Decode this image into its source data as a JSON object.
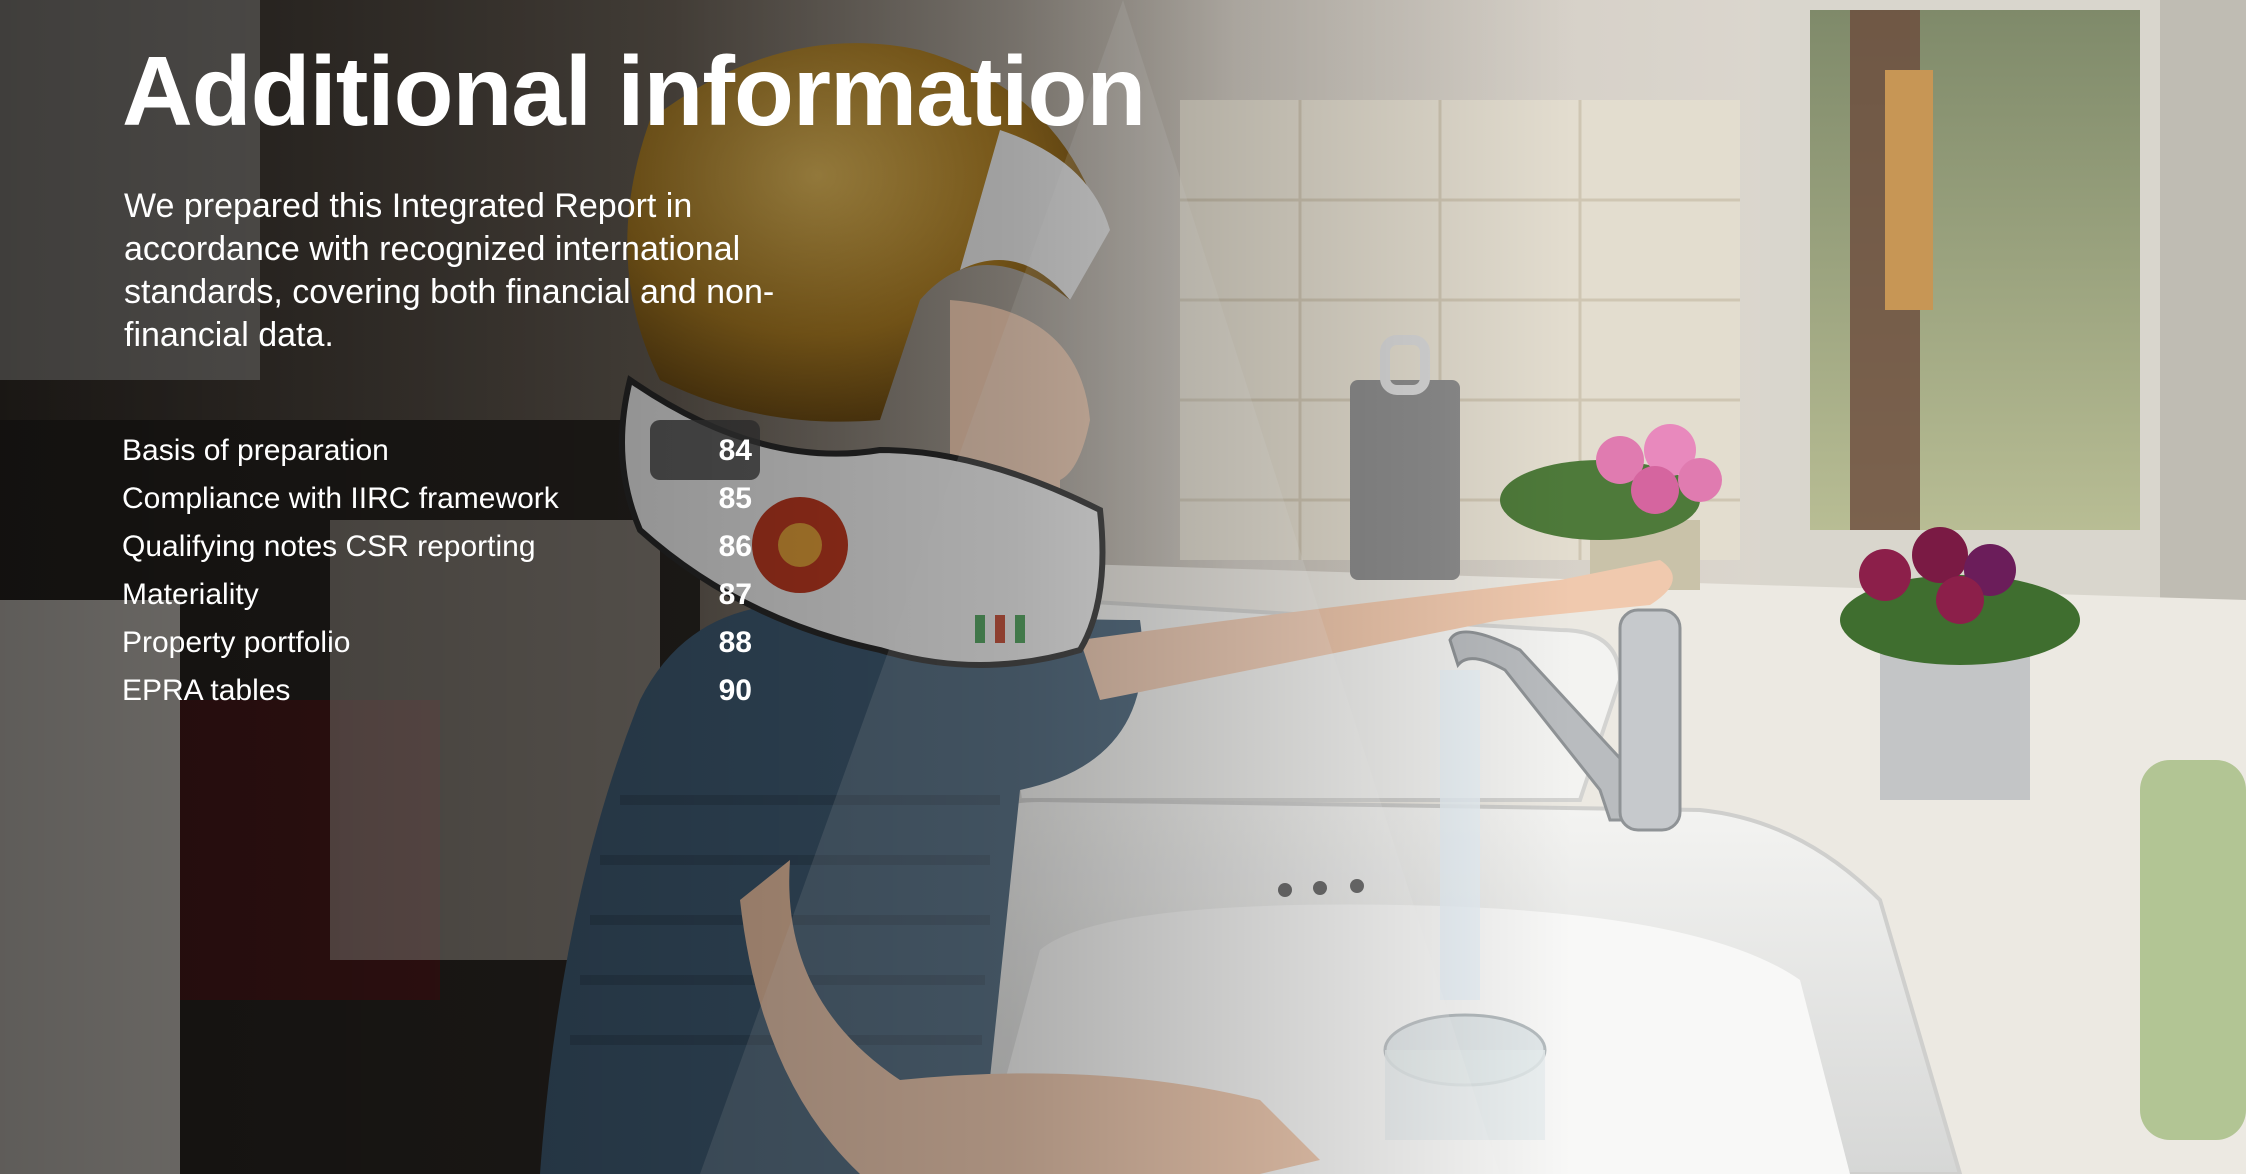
{
  "page": {
    "title": "Additional information",
    "intro": "We prepared this Integrated Report in accordance with recognized international standards, covering both financial and non-financial data.",
    "photo_icon": "child-in-astronaut-helmet-washing-dishes-photo"
  },
  "toc": {
    "items": [
      {
        "label": "Basis of preparation",
        "page": "84"
      },
      {
        "label": "Compliance with IIRC framework",
        "page": "85"
      },
      {
        "label": "Qualifying notes CSR reporting",
        "page": "86"
      },
      {
        "label": "Materiality",
        "page": "87"
      },
      {
        "label": "Property portfolio",
        "page": "88"
      },
      {
        "label": "EPRA tables",
        "page": "90"
      }
    ]
  },
  "colors": {
    "text": "#ffffff",
    "helmet_gold": "#b88a2a",
    "shirt_blue": "#3f5b73",
    "flower_pink": "#e07bb0",
    "flower_magenta": "#8c1f4a"
  }
}
